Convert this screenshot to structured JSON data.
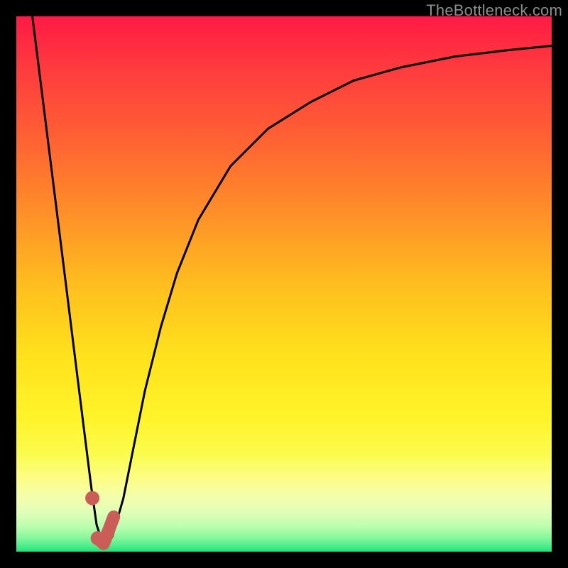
{
  "watermark": "TheBottleneck.com",
  "colors": {
    "frame": "#000000",
    "curve_stroke": "#000000",
    "marker_fill": "#cb5d58",
    "gradient_top": "#ff1a44",
    "gradient_bottom": "#16e57a"
  },
  "chart_data": {
    "type": "line",
    "title": "",
    "xlabel": "",
    "ylabel": "",
    "xlim": [
      0,
      100
    ],
    "ylim": [
      0,
      100
    ],
    "note": "No axes or tick labels; y plotted inverted (0 at bottom, 100 at top). Background gradient red→green encodes value from high (top) to optimal (bottom).",
    "series": [
      {
        "name": "bottleneck-curve",
        "x": [
          3,
          5,
          7,
          9,
          11,
          13,
          14,
          15,
          16,
          17,
          18,
          20,
          22,
          24,
          27,
          30,
          34,
          40,
          47,
          55,
          63,
          72,
          82,
          92,
          100
        ],
        "y": [
          100,
          84,
          68,
          52,
          36,
          20,
          12,
          5,
          2,
          1,
          3,
          10,
          20,
          30,
          42,
          52,
          62,
          72,
          79,
          84,
          88,
          90.5,
          92.5,
          93.7,
          94.5
        ]
      }
    ],
    "markers": [
      {
        "name": "point-a",
        "x": 14.2,
        "y": 10
      },
      {
        "name": "point-b",
        "x": 15.2,
        "y": 2.5
      },
      {
        "name": "stroke-end-1",
        "x": 16.3,
        "y": 1.5
      },
      {
        "name": "stroke-end-2",
        "x": 18.2,
        "y": 6.5
      }
    ]
  }
}
